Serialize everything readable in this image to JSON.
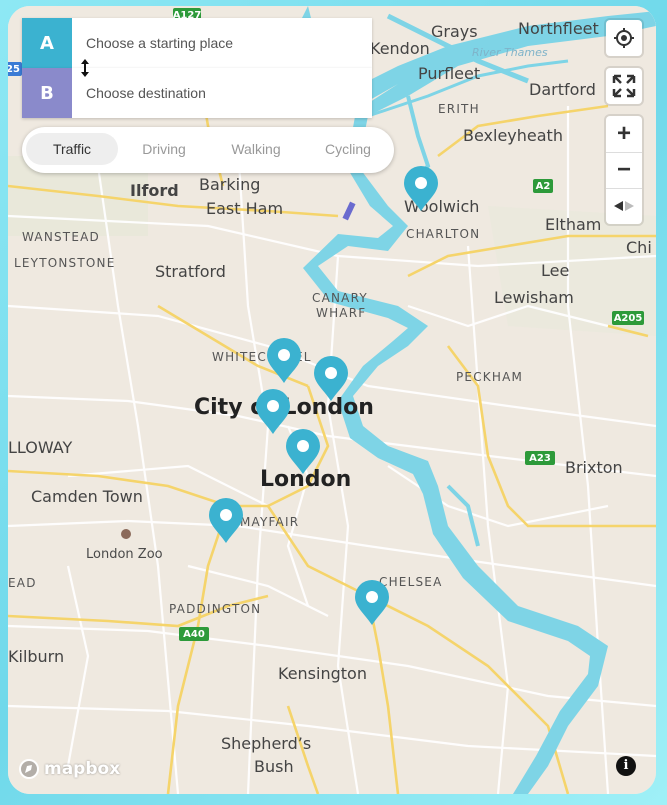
{
  "directions": {
    "origin": {
      "badge": "A",
      "placeholder": "Choose a starting place"
    },
    "destination": {
      "badge": "B",
      "placeholder": "Choose destination"
    }
  },
  "modes": [
    {
      "label": "Traffic",
      "active": true
    },
    {
      "label": "Driving",
      "active": false
    },
    {
      "label": "Walking",
      "active": false
    },
    {
      "label": "Cycling",
      "active": false
    }
  ],
  "controls": {
    "geolocate_icon": "crosshair-icon",
    "fullscreen_icon": "expand-icon",
    "zoom_in": "+",
    "zoom_out": "−",
    "compass_icon": "compass-icon"
  },
  "attribution": {
    "logo": "mapbox",
    "info": "i"
  },
  "colors": {
    "water": "#7ed4e6",
    "marker": "#3bb2d0",
    "badge_a": "#3bb2d0",
    "badge_b": "#8a8acb",
    "road_shield": "#2d9a3a"
  },
  "map": {
    "labels": {
      "northfleet": "Northfleet",
      "grays": "Grays",
      "river_thames": "River Thames",
      "kendon": "Kendon",
      "purfleet": "Purfleet",
      "dartford": "Dartford",
      "erith": "ERITH",
      "bexleyheath": "Bexleyheath",
      "ilford": "Ilford",
      "barking": "Barking",
      "east_ham": "East Ham",
      "woolwich": "Woolwich",
      "charlton": "CHARLTON",
      "eltham": "Eltham",
      "chi": "Chi",
      "wanstead": "WANSTEAD",
      "leytonstone": "LEYTONSTONE",
      "stratford": "Stratford",
      "lee": "Lee",
      "lewisham": "Lewisham",
      "canary_wharf_1": "CANARY",
      "canary_wharf_2": "WHARF",
      "whitechapel": "WHITECHAPEL",
      "peckham": "PECKHAM",
      "city_of_london": "City of London",
      "holloway": "LLOWAY",
      "london": "London",
      "brixton": "Brixton",
      "camden_town": "Camden Town",
      "mayfair": "MAYFAIR",
      "london_zoo": "London Zoo",
      "chelsea": "CHELSEA",
      "head": "EAD",
      "paddington": "PADDINGTON",
      "kilburn": "Kilburn",
      "kensington": "Kensington",
      "shepherds_1": "Shepherd’s",
      "shepherds_2": "Bush"
    },
    "road_shields": {
      "a127": "A127",
      "a2": "A2",
      "a205": "A205",
      "a23": "A23",
      "a40": "A40",
      "m25": "25"
    }
  }
}
